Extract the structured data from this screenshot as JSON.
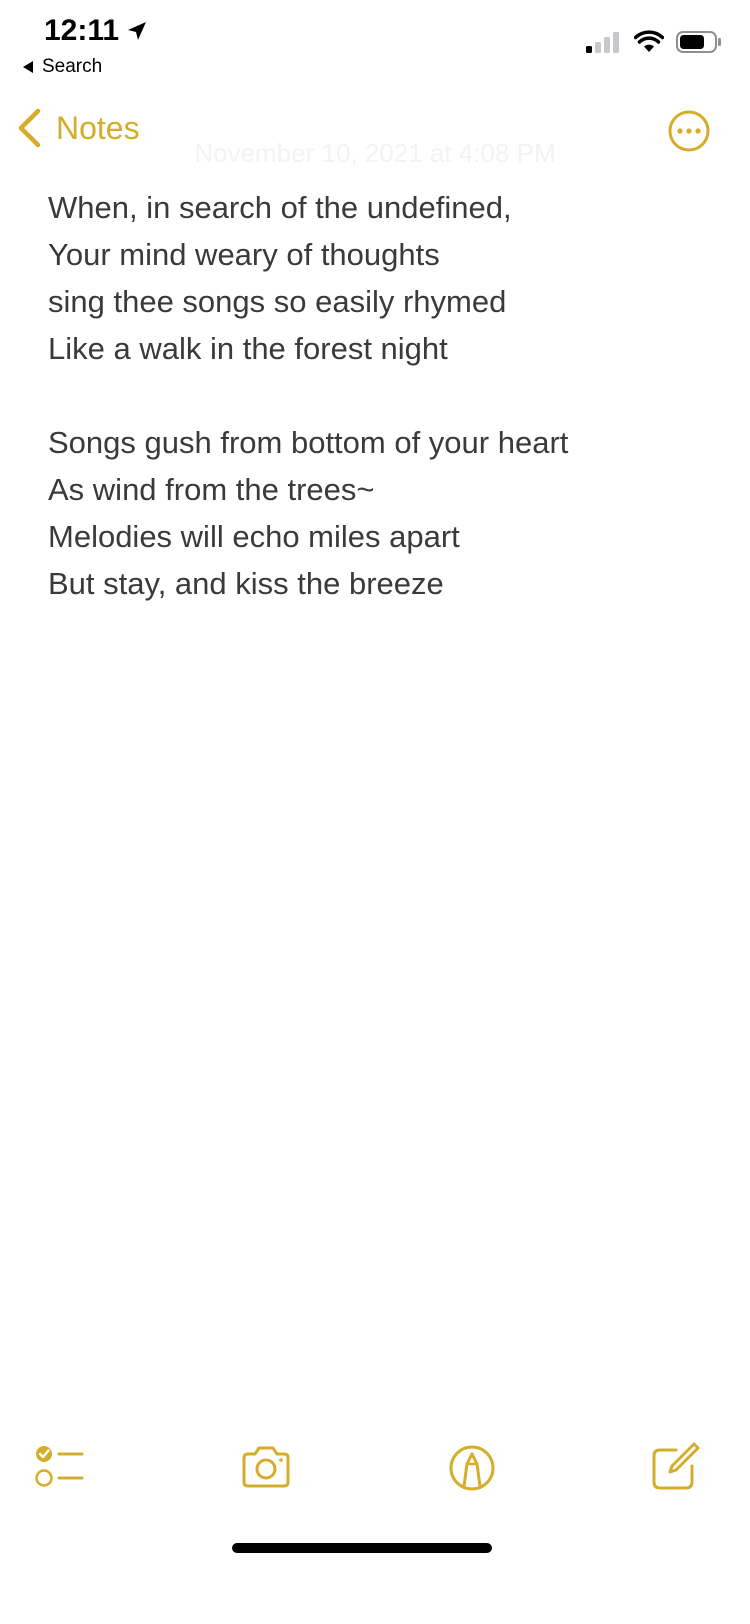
{
  "status_bar": {
    "time": "12:11",
    "back_app": "Search",
    "location_icon": "location-arrow-icon",
    "signal_icon": "cellular-signal-icon",
    "wifi_icon": "wifi-icon",
    "battery_icon": "battery-icon"
  },
  "nav": {
    "back_label": "Notes",
    "back_icon": "chevron-left-icon",
    "more_icon": "ellipsis-circle-icon",
    "date_text": "November 10, 2021 at 4:08 PM"
  },
  "note": {
    "stanza_1": [
      "When, in search of the undefined,",
      "Your mind weary of thoughts",
      "sing thee songs so easily rhymed",
      "Like a walk in the forest night"
    ],
    "stanza_2": [
      "Songs gush from bottom of your heart",
      "As wind from the trees~",
      "Melodies will echo miles apart",
      "But stay, and kiss the breeze"
    ]
  },
  "toolbar": {
    "checklist_icon": "checklist-icon",
    "camera_icon": "camera-icon",
    "markup_icon": "markup-pen-icon",
    "compose_icon": "compose-icon"
  },
  "colors": {
    "accent": "#d6ac2b",
    "text": "#3a3a3c",
    "background": "#ffffff"
  }
}
